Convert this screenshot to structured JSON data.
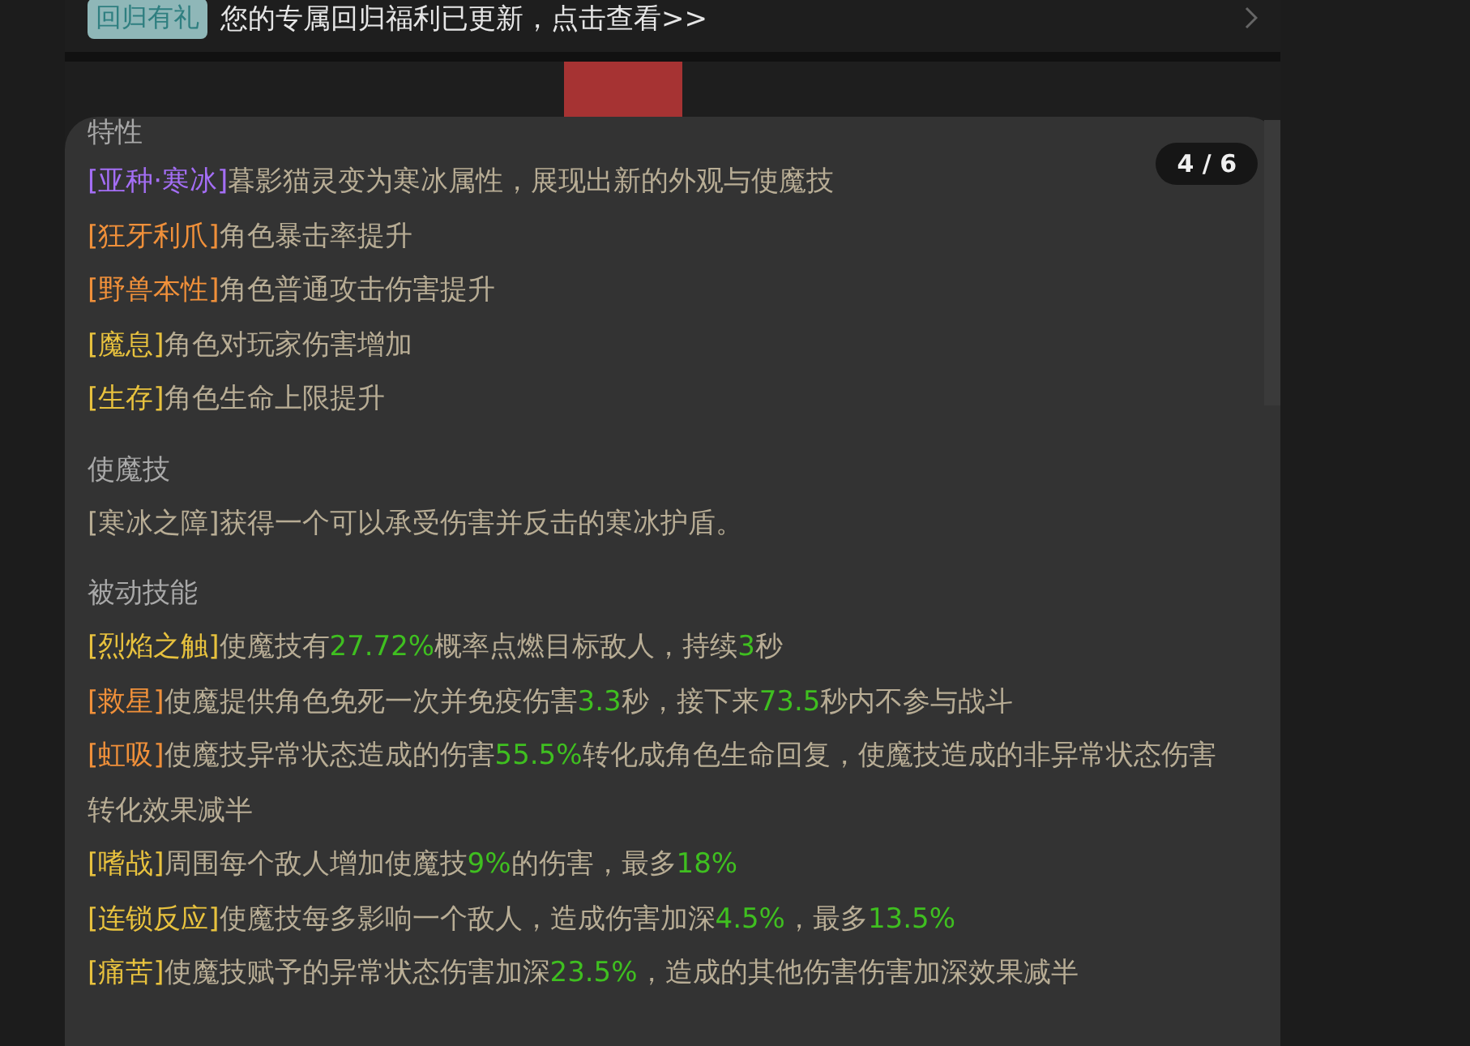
{
  "banner": {
    "badge": "回归有礼",
    "text": "您的专属回归福利已更新，点击查看>>"
  },
  "pager": "4 / 6",
  "sections": [
    {
      "title": "特性",
      "entries": [
        {
          "tag": "[亚种·寒冰]",
          "color": "#a46ef5",
          "parts": [
            {
              "text": "暮影猫灵变为寒冰属性，展现出新的外观与使魔技",
              "highlight": false
            }
          ]
        },
        {
          "tag": "[狂牙利爪]",
          "color": "#f0903a",
          "parts": [
            {
              "text": "角色暴击率提升",
              "highlight": false
            }
          ]
        },
        {
          "tag": "[野兽本性]",
          "color": "#f0903a",
          "parts": [
            {
              "text": "角色普通攻击伤害提升",
              "highlight": false
            }
          ]
        },
        {
          "tag": "[魔息]",
          "color": "#e8c23e",
          "parts": [
            {
              "text": "角色对玩家伤害增加",
              "highlight": false
            }
          ]
        },
        {
          "tag": "[生存]",
          "color": "#e8c23e",
          "parts": [
            {
              "text": "角色生命上限提升",
              "highlight": false
            }
          ]
        }
      ]
    },
    {
      "title": "使魔技",
      "entries": [
        {
          "parts": [
            {
              "text": "[寒冰之障]获得一个可以承受伤害并反击的寒冰护盾。",
              "highlight": false
            }
          ]
        }
      ]
    },
    {
      "title": "被动技能",
      "entries": [
        {
          "tag": "[烈焰之触]",
          "color": "#e8c23e",
          "parts": [
            {
              "text": "使魔技有",
              "highlight": false
            },
            {
              "text": "27.72%",
              "highlight": true
            },
            {
              "text": "概率点燃目标敌人，持续",
              "highlight": false
            },
            {
              "text": "3",
              "highlight": true
            },
            {
              "text": "秒",
              "highlight": false
            }
          ]
        },
        {
          "tag": "[救星]",
          "color": "#f0903a",
          "parts": [
            {
              "text": "使魔提供角色免死一次并免疫伤害",
              "highlight": false
            },
            {
              "text": "3.3",
              "highlight": true
            },
            {
              "text": "秒，接下来",
              "highlight": false
            },
            {
              "text": "73.5",
              "highlight": true
            },
            {
              "text": "秒内不参与战斗",
              "highlight": false
            }
          ]
        },
        {
          "tag": "[虹吸]",
          "color": "#f0903a",
          "parts": [
            {
              "text": "使魔技异常状态造成的伤害",
              "highlight": false
            },
            {
              "text": "55.5%",
              "highlight": true
            },
            {
              "text": "转化成角色生命回复，使魔技造成的非异常状态伤害转化效果减半",
              "highlight": false
            }
          ]
        },
        {
          "tag": "[嗜战]",
          "color": "#e8c23e",
          "parts": [
            {
              "text": "周围每个敌人增加使魔技",
              "highlight": false
            },
            {
              "text": "9%",
              "highlight": true
            },
            {
              "text": "的伤害，最多",
              "highlight": false
            },
            {
              "text": "18%",
              "highlight": true
            }
          ]
        },
        {
          "tag": "[连锁反应]",
          "color": "#e8c23e",
          "parts": [
            {
              "text": "使魔技每多影响一个敌人，造成伤害加深",
              "highlight": false
            },
            {
              "text": "4.5%",
              "highlight": true
            },
            {
              "text": "，最多",
              "highlight": false
            },
            {
              "text": "13.5%",
              "highlight": true
            }
          ]
        },
        {
          "tag": "[痛苦]",
          "color": "#e8c23e",
          "parts": [
            {
              "text": "使魔技赋予的异常状态伤害加深",
              "highlight": false
            },
            {
              "text": "23.5%",
              "highlight": true
            },
            {
              "text": "，造成的其他伤害伤害加深效果减半",
              "highlight": false
            }
          ]
        }
      ]
    }
  ]
}
